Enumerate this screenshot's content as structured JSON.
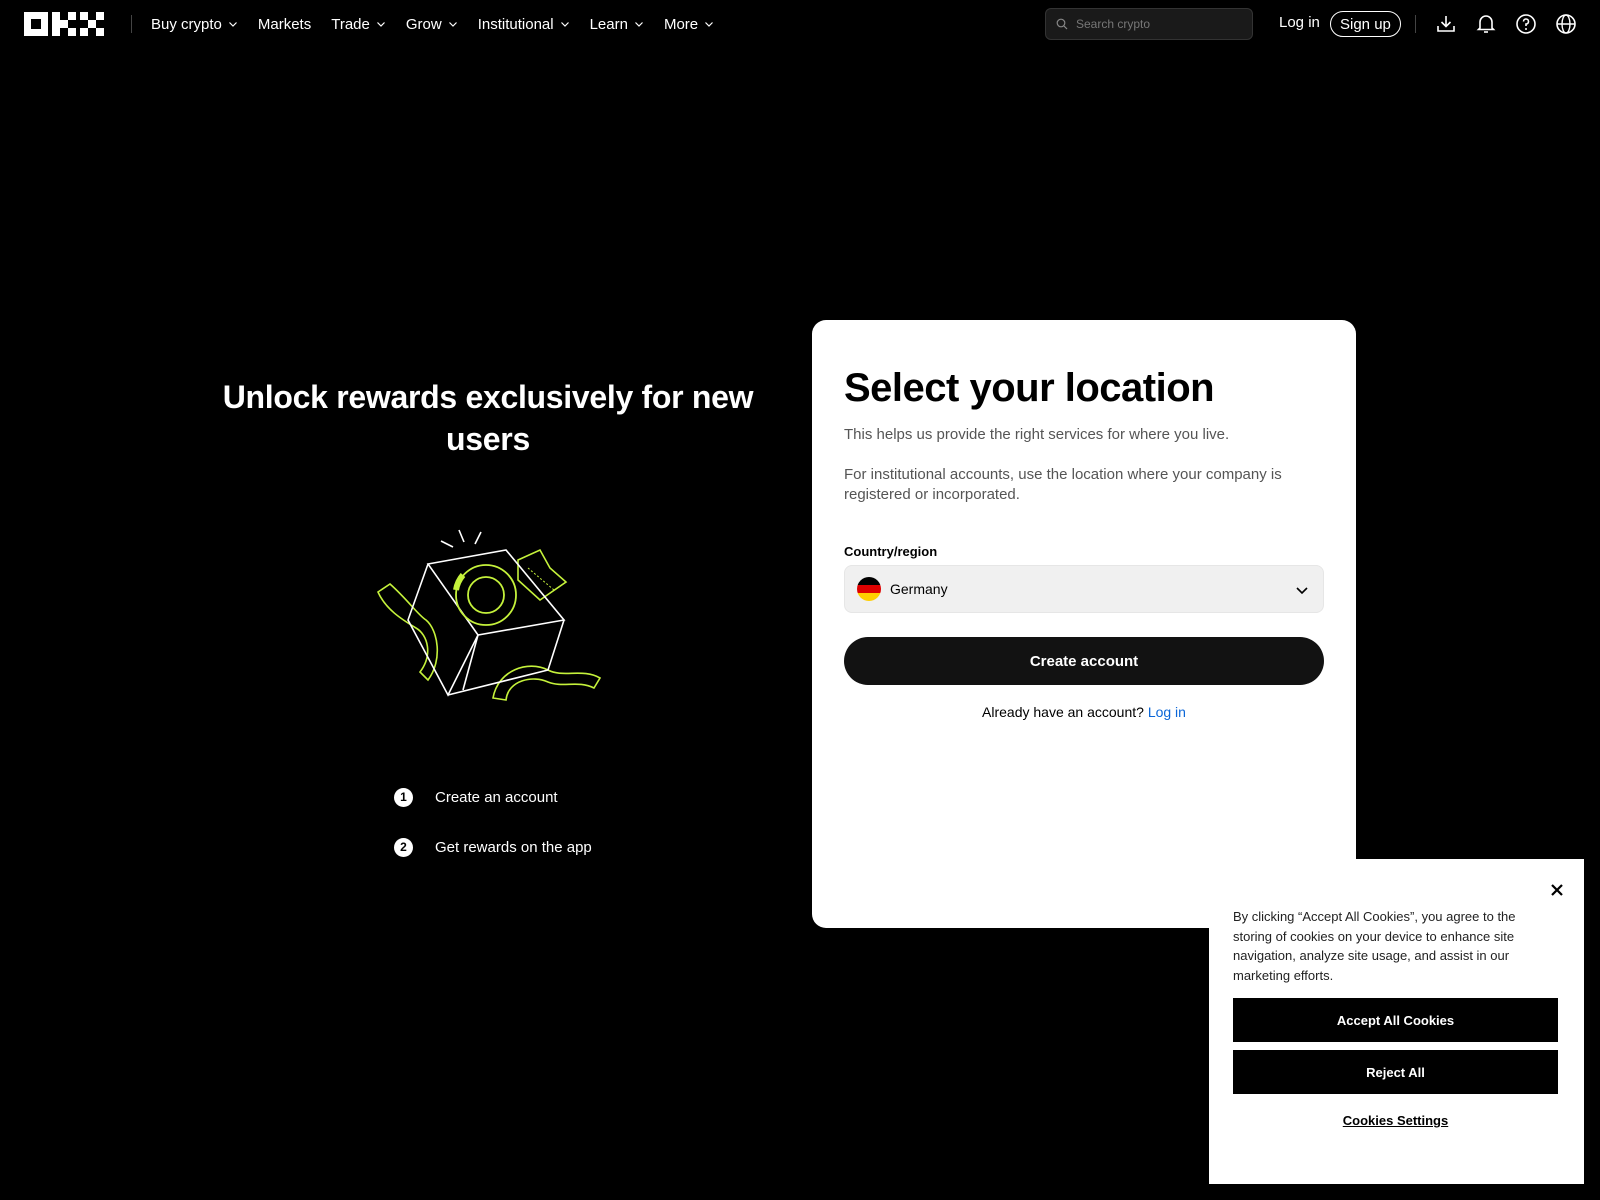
{
  "nav": {
    "logo": "okx-logo",
    "items": [
      {
        "label": "Buy crypto",
        "has_dropdown": true
      },
      {
        "label": "Markets",
        "has_dropdown": false
      },
      {
        "label": "Trade",
        "has_dropdown": true
      },
      {
        "label": "Grow",
        "has_dropdown": true
      },
      {
        "label": "Institutional",
        "has_dropdown": true
      },
      {
        "label": "Learn",
        "has_dropdown": true
      },
      {
        "label": "More",
        "has_dropdown": true
      }
    ],
    "search_placeholder": "Search crypto",
    "login_label": "Log in",
    "signup_label": "Sign up",
    "icons": [
      "download-icon",
      "bell-icon",
      "help-icon",
      "globe-icon"
    ]
  },
  "promo": {
    "title": "Unlock rewards exclusively for new users",
    "steps": [
      {
        "num": "1",
        "text": "Create an account"
      },
      {
        "num": "2",
        "text": "Get rewards on the app"
      }
    ],
    "accent": "#c5f23b"
  },
  "card": {
    "title": "Select your location",
    "desc1": "This helps us provide the right services for where you live.",
    "desc2": "For institutional accounts, use the location where your company is registered or incorporated.",
    "field_label": "Country/region",
    "selected_country": "Germany",
    "create_label": "Create account",
    "already_text": "Already have an account?",
    "login_link": "Log in"
  },
  "cookie": {
    "text": "By clicking “Accept All Cookies”, you agree to the storing of cookies on your device to enhance site navigation, analyze site usage, and assist in our marketing efforts.",
    "accept_label": "Accept All Cookies",
    "reject_label": "Reject All",
    "settings_label": "Cookies Settings"
  }
}
